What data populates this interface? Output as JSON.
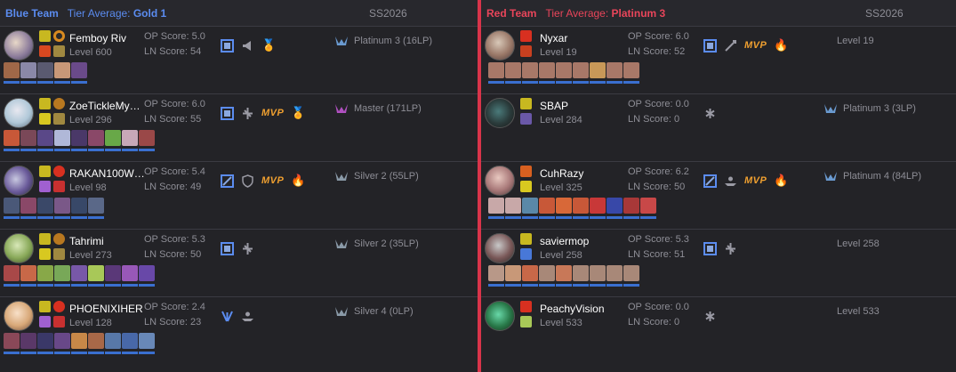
{
  "blue": {
    "team_label": "Blue Team",
    "tier_prefix": "Tier Average: ",
    "tier_value": "Gold 1",
    "season": "SS2026",
    "players": [
      {
        "name": "Femboy Riv",
        "level": "Level 600",
        "op": "OP Score: 5.0",
        "ln": "LN Score: 54",
        "rank": "Platinum 3 (16LP)",
        "mvp": "",
        "award": "medal-icon"
      },
      {
        "name": "ZoeTickleMy…",
        "level": "Level 296",
        "op": "OP Score: 6.0",
        "ln": "LN Score: 55",
        "rank": "Master (171LP)",
        "mvp": "MVP",
        "award": "medal-icon"
      },
      {
        "name": "RAKAN100W…",
        "level": "Level 98",
        "op": "OP Score: 5.4",
        "ln": "LN Score: 49",
        "rank": "Silver 2 (55LP)",
        "mvp": "MVP",
        "award": "fire-icon"
      },
      {
        "name": "Tahrimi",
        "level": "Level 273",
        "op": "OP Score: 5.3",
        "ln": "LN Score: 50",
        "rank": "Silver 2 (35LP)",
        "mvp": "",
        "award": ""
      },
      {
        "name": "PHOENIXIHER",
        "level": "Level 128",
        "op": "OP Score: 2.4",
        "ln": "LN Score: 23",
        "rank": "Silver 4 (0LP)",
        "mvp": "",
        "award": ""
      }
    ]
  },
  "red": {
    "team_label": "Red Team",
    "tier_prefix": "Tier Average: ",
    "tier_value": "Platinum 3",
    "season": "SS2026",
    "players": [
      {
        "name": "Nyxar",
        "level": "Level 19",
        "op": "OP Score: 6.0",
        "ln": "LN Score: 52",
        "rank": "Level 19",
        "mvp": "MVP",
        "award": "fire-icon"
      },
      {
        "name": "SBAP",
        "level": "Level 284",
        "op": "OP Score: 0.0",
        "ln": "LN Score: 0",
        "rank": "Platinum 3 (3LP)",
        "mvp": "",
        "award": ""
      },
      {
        "name": "CuhRazy",
        "level": "Level 325",
        "op": "OP Score: 6.2",
        "ln": "LN Score: 50",
        "rank": "Platinum 4 (84LP)",
        "mvp": "MVP",
        "award": "fire-icon"
      },
      {
        "name": "saviermop",
        "level": "Level 258",
        "op": "OP Score: 5.3",
        "ln": "LN Score: 51",
        "rank": "Level 258",
        "mvp": "",
        "award": ""
      },
      {
        "name": "PeachyVision",
        "level": "Level 533",
        "op": "OP Score: 0.0",
        "ln": "LN Score: 0",
        "rank": "Level 533",
        "mvp": "",
        "award": ""
      }
    ]
  },
  "colors": {
    "blue_accent": "#5b8cf0",
    "red_accent": "#e8455a",
    "mvp": "#f0a030",
    "background": "#232327"
  }
}
